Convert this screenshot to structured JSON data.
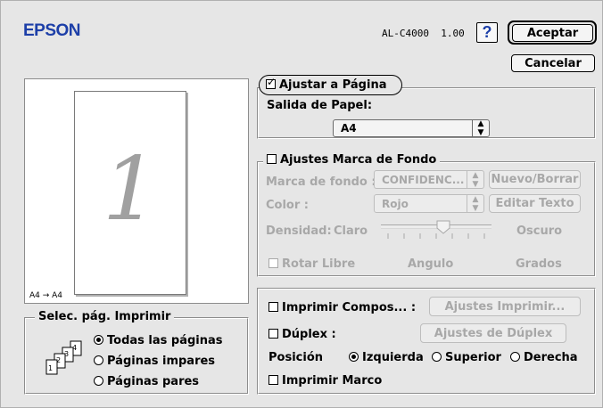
{
  "brand": {
    "logo_text": "EPSON",
    "color": "#1d3fa8"
  },
  "header": {
    "model_version": "AL-C4000  1.00",
    "help_label": "?"
  },
  "buttons": {
    "accept": "Aceptar",
    "cancel": "Cancelar"
  },
  "preview": {
    "page_number": "1",
    "paper_flow": "A4 → A4"
  },
  "fit_page": {
    "checkbox_label": "Ajustar a Página",
    "checked": true,
    "output_paper_label": "Salida de Papel:",
    "output_paper_value": "A4"
  },
  "watermark": {
    "checkbox_label": "Ajustes Marca de Fondo",
    "checked": false,
    "watermark_label": "Marca de fondo :",
    "watermark_value": "CONFIDENC...",
    "new_delete_button": "Nuevo/Borrar",
    "color_label": "Color :",
    "color_value": "Rojo",
    "edit_text_button": "Editar Texto",
    "density_label": "Densidad:",
    "density_light": "Claro",
    "density_dark": "Oscuro",
    "density_level": 0.5,
    "rotate_free_label": "Rotar Libre",
    "angle_label": "Angulo",
    "degrees_label": "Grados"
  },
  "page_select": {
    "title": "Selec. pág. Imprimir",
    "options": [
      "Todas las páginas",
      "Páginas impares",
      "Páginas pares"
    ],
    "selected_index": 0
  },
  "layout": {
    "print_compose_label": "Imprimir Compos... :",
    "print_settings_button": "Ajustes Imprimir...",
    "duplex_label": "Dúplex :",
    "duplex_settings_button": "Ajustes de Dúplex",
    "position_label": "Posición",
    "position_options": [
      "Izquierda",
      "Superior",
      "Derecha"
    ],
    "position_selected_index": 0,
    "print_frame_label": "Imprimir Marco"
  }
}
